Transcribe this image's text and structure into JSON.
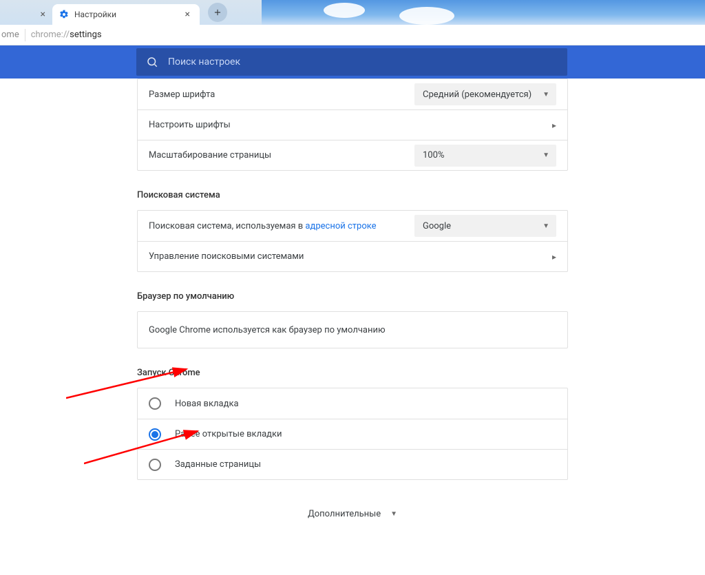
{
  "tabs": {
    "active_title": "Настройки"
  },
  "address": {
    "origin": "ome",
    "scheme": "chrome://",
    "path": "settings"
  },
  "search": {
    "placeholder": "Поиск настроек"
  },
  "appearance": {
    "font_size_label": "Размер шрифта",
    "font_size_value": "Средний (рекомендуется)",
    "customize_fonts": "Настроить шрифты",
    "page_zoom_label": "Масштабирование страницы",
    "page_zoom_value": "100%"
  },
  "search_engine": {
    "title": "Поисковая система",
    "used_in_prefix": "Поисковая система, используемая в ",
    "used_in_link": "адресной строке",
    "value": "Google",
    "manage": "Управление поисковыми системами"
  },
  "default_browser": {
    "title": "Браузер по умолчанию",
    "status": "Google Chrome используется как браузер по умолчанию"
  },
  "startup": {
    "title": "Запуск Chrome",
    "options": [
      {
        "label": "Новая вкладка",
        "selected": false
      },
      {
        "label": "Ранее открытые вкладки",
        "selected": true
      },
      {
        "label": "Заданные страницы",
        "selected": false
      }
    ]
  },
  "more": "Дополнительные"
}
